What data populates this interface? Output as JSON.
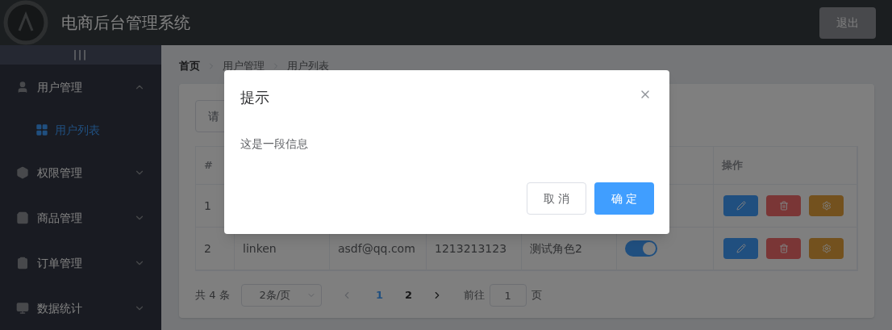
{
  "header": {
    "title": "电商后台管理系统",
    "logout": "退出"
  },
  "sidebar": {
    "toggle": "|||",
    "items": [
      {
        "label": "用户管理",
        "expanded": true,
        "children": [
          {
            "label": "用户列表",
            "selected": true
          }
        ]
      },
      {
        "label": "权限管理",
        "expanded": false
      },
      {
        "label": "商品管理",
        "expanded": false
      },
      {
        "label": "订单管理",
        "expanded": false
      },
      {
        "label": "数据统计",
        "expanded": false
      }
    ]
  },
  "breadcrumb": [
    "首页",
    "用户管理",
    "用户列表"
  ],
  "search": {
    "placeholder": "请"
  },
  "table": {
    "columns": [
      "#",
      "操作"
    ],
    "rows": [
      {
        "cells": [
          "1"
        ]
      },
      {
        "cells": [
          "2",
          "linken",
          "asdf@qq.com",
          "1213213123",
          "测试角色2"
        ],
        "state_on": true
      }
    ]
  },
  "pagination": {
    "total": "共 4 条",
    "page_size": "2条/页",
    "pages": [
      {
        "label": "1",
        "selected": true
      },
      {
        "label": "2",
        "selected": false
      }
    ],
    "goto_label": "前往",
    "goto_value": "1",
    "goto_unit": "页"
  },
  "dialog": {
    "title": "提示",
    "message": "这是一段信息",
    "cancel": "取 消",
    "confirm": "确 定"
  }
}
